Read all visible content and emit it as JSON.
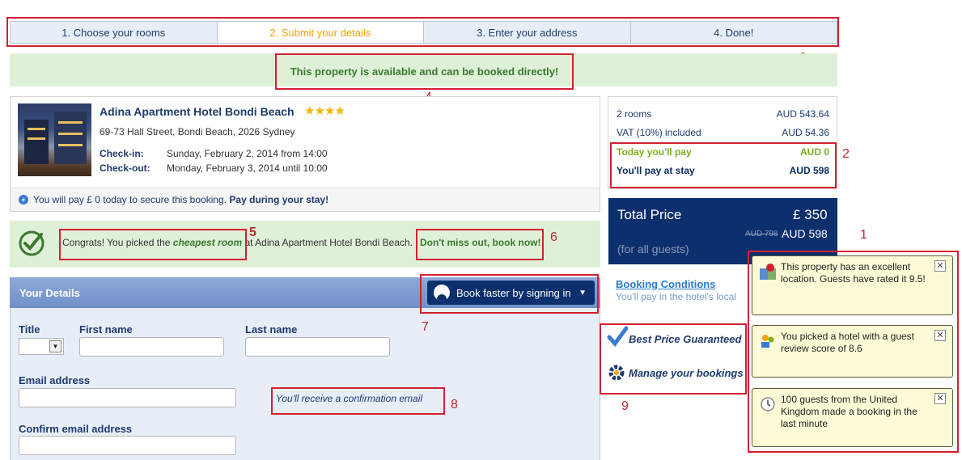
{
  "steps": [
    {
      "label": "1. Choose your rooms"
    },
    {
      "label": "2. Submit your details"
    },
    {
      "label": "3. Enter your address"
    },
    {
      "label": "4. Done!"
    }
  ],
  "availability": "This property is available and can be booked directly!",
  "hotel": {
    "name": "Adina Apartment Hotel Bondi Beach",
    "stars": "★★★★",
    "address": "69-73 Hall Street, Bondi Beach, 2026 Sydney",
    "checkin_label": "Check-in:",
    "checkin_value": "Sunday, February 2, 2014 from 14:00",
    "checkout_label": "Check-out:",
    "checkout_value": "Monday, February 3, 2014 until 10:00",
    "pay_note": "You will pay £ 0 today to secure this booking.",
    "pay_note_bold": "Pay during your stay!"
  },
  "price": {
    "rooms_label": "2 rooms",
    "rooms_value": "AUD 543.64",
    "vat_label": "VAT (10%) included",
    "vat_value": "AUD 54.36",
    "today_label": "Today you'll pay",
    "today_value": "AUD 0",
    "stay_label": "You'll pay at stay",
    "stay_value": "AUD 598"
  },
  "total": {
    "label": "Total Price",
    "value": "£ 350",
    "old": "AUD 798",
    "aud": "AUD 598",
    "sub": "(for all guests)"
  },
  "congrats": {
    "prefix": "Congrats! You picked the",
    "em": "cheapest room",
    "suffix": "at Adina Apartment Hotel Bondi Beach.",
    "cta": "Don't miss out, book now!"
  },
  "details": {
    "title": "Your Details",
    "signin": "Book faster by signing in",
    "title_label": "Title",
    "first_label": "First name",
    "last_label": "Last name",
    "email_label": "Email address",
    "confirm_label": "Confirm email address",
    "confirm_note": "You'll receive a confirmation email"
  },
  "side": {
    "booking_conditions": "Booking Conditions",
    "booking_note": "You'll pay in the hotel's local",
    "best_price": "Best Price Guaranteed",
    "manage": "Manage your bookings"
  },
  "notes": [
    {
      "text": "This property has an excellent location. Guests have rated it 9.5!"
    },
    {
      "text": "You picked a hotel with a guest review score of 8.6"
    },
    {
      "text": "100 guests from the United Kingdom made a booking in the last minute"
    }
  ],
  "markers": [
    "1",
    "2",
    "3",
    "4",
    "5",
    "6",
    "7",
    "8",
    "9"
  ],
  "colors": {
    "navy": "#0c2f6e",
    "green": "#3a7a2e",
    "highlight": "#d32030",
    "active_step": "#f0a30a"
  }
}
